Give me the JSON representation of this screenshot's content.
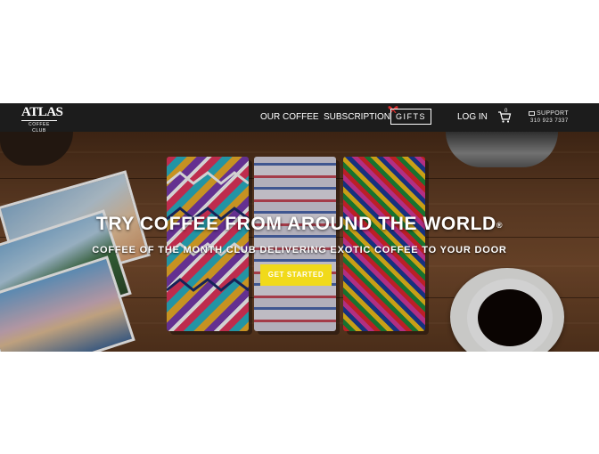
{
  "brand": {
    "name": "ATLAS",
    "tagline": "COFFEE CLUB"
  },
  "nav": {
    "items": [
      "OUR COFFEE",
      "SUBSCRIPTION",
      "GIFTS",
      "LOG IN"
    ],
    "cart_icon": "cart-icon",
    "cart_count": "0",
    "support_label": "SUPPORT",
    "support_phone": "310 923 7337"
  },
  "hero": {
    "headline": "TRY COFFEE FROM AROUND THE WORLD",
    "headline_mark": "®",
    "subheadline": "COFFEE OF THE MONTH CLUB DELIVERING EXOTIC COFFEE TO YOUR DOOR",
    "cta_label": "GET STARTED"
  },
  "colors": {
    "nav_bg": "#1c1c1c",
    "cta_bg": "#f1da1a",
    "gift_bow": "#d42b2b",
    "wood": "#6b4429"
  }
}
